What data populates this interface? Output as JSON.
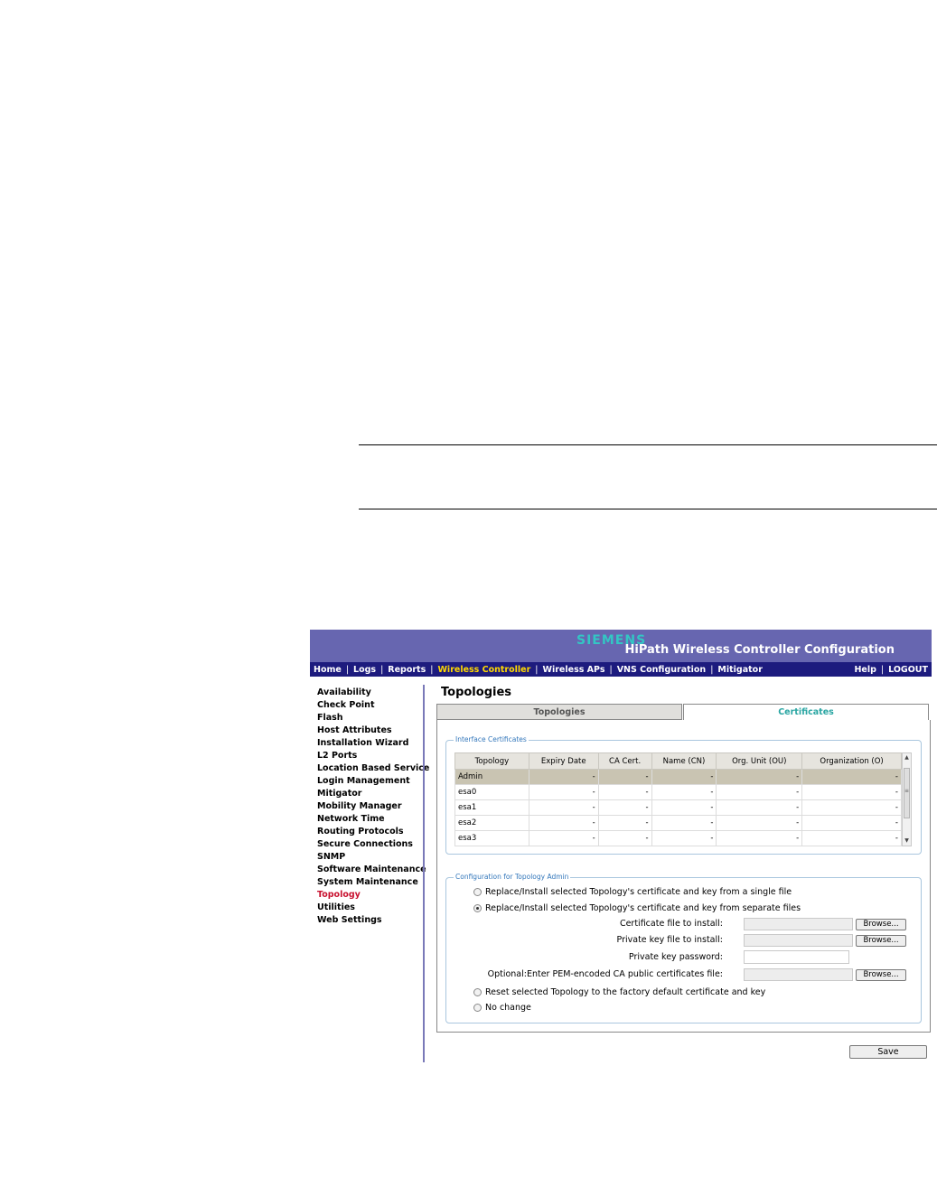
{
  "brand": "SIEMENS",
  "app_title": "HiPath Wireless Controller Configuration",
  "topnav": {
    "left": [
      {
        "label": "Home"
      },
      {
        "label": "Logs"
      },
      {
        "label": "Reports"
      },
      {
        "label": "Wireless Controller",
        "active": true
      },
      {
        "label": "Wireless APs"
      },
      {
        "label": "VNS Configuration"
      },
      {
        "label": "Mitigator"
      }
    ],
    "right": [
      {
        "label": "Help"
      },
      {
        "label": "LOGOUT"
      }
    ],
    "separator": "|",
    "colors": {
      "banner": "#6766b0",
      "nav": "#1d1b7e",
      "active_link": "#ffd800",
      "brand": "#33c6c4"
    }
  },
  "sidebar": {
    "items": [
      {
        "label": "Availability"
      },
      {
        "label": "Check Point"
      },
      {
        "label": "Flash"
      },
      {
        "label": "Host Attributes"
      },
      {
        "label": "Installation Wizard"
      },
      {
        "label": "L2 Ports"
      },
      {
        "label": "Location Based Service"
      },
      {
        "label": "Login Management"
      },
      {
        "label": "Mitigator"
      },
      {
        "label": "Mobility Manager"
      },
      {
        "label": "Network Time"
      },
      {
        "label": "Routing Protocols"
      },
      {
        "label": "Secure Connections"
      },
      {
        "label": "SNMP"
      },
      {
        "label": "Software Maintenance"
      },
      {
        "label": "System Maintenance"
      },
      {
        "label": "Topology",
        "active": true
      },
      {
        "label": "Utilities"
      },
      {
        "label": "Web Settings"
      }
    ],
    "active_color": "#c8102e"
  },
  "page_title": "Topologies",
  "tabs": [
    {
      "label": "Topologies",
      "active": false
    },
    {
      "label": "Certificates",
      "active": true
    }
  ],
  "interface_certificates": {
    "legend": "Interface Certificates",
    "columns": [
      "Topology",
      "Expiry Date",
      "CA Cert.",
      "Name (CN)",
      "Org. Unit (OU)",
      "Organization (O)"
    ],
    "rows": [
      {
        "cells": [
          "Admin",
          "-",
          "-",
          "-",
          "-",
          "-"
        ],
        "selected": true
      },
      {
        "cells": [
          "esa0",
          "-",
          "-",
          "-",
          "-",
          "-"
        ]
      },
      {
        "cells": [
          "esa1",
          "-",
          "-",
          "-",
          "-",
          "-"
        ]
      },
      {
        "cells": [
          "esa2",
          "-",
          "-",
          "-",
          "-",
          "-"
        ]
      },
      {
        "cells": [
          "esa3",
          "-",
          "-",
          "-",
          "-",
          "-"
        ]
      }
    ],
    "scrollbar": {
      "up_icon": "▲",
      "down_icon": "▼",
      "grip": "≡"
    }
  },
  "configuration": {
    "legend": "Configuration for Topology Admin",
    "options": [
      {
        "label": "Replace/Install selected Topology's certificate and key from a single file",
        "checked": false
      },
      {
        "label": "Replace/Install selected Topology's certificate and key from separate files",
        "checked": true
      },
      {
        "label": "Reset selected Topology to the factory default certificate and key",
        "checked": false
      },
      {
        "label": "No change",
        "checked": false
      }
    ],
    "fields": {
      "cert_file_label": "Certificate file to install:",
      "key_file_label": "Private key file to install:",
      "key_password_label": "Private key password:",
      "ca_file_label": "Optional:Enter PEM-encoded CA public certificates file:",
      "cert_file_value": "",
      "key_file_value": "",
      "key_password_value": "",
      "ca_file_value": ""
    },
    "browse_label": "Browse..."
  },
  "save_label": "Save"
}
